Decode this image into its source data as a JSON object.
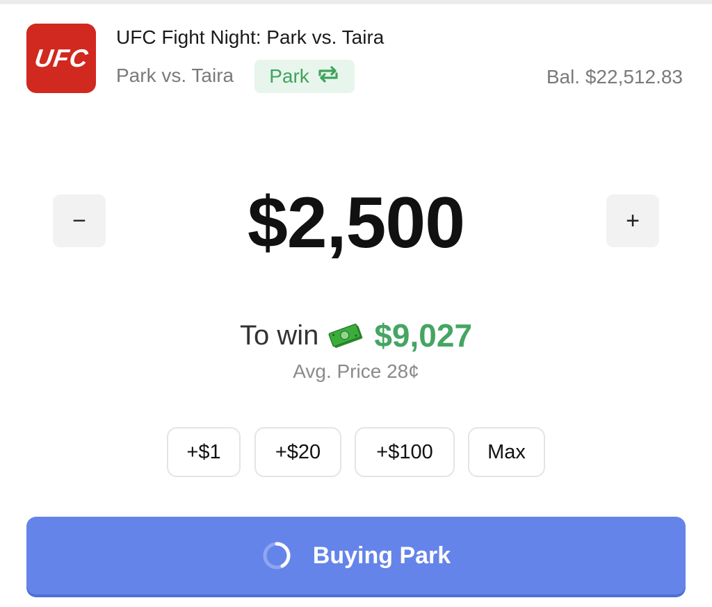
{
  "header": {
    "logo_text": "UFC",
    "event_title": "UFC Fight Night: Park vs. Taira",
    "matchup": "Park vs. Taira",
    "pick_label": "Park",
    "pick_icon": "swap-icon",
    "balance": "Bal. $22,512.83"
  },
  "wager": {
    "decrement_label": "−",
    "increment_label": "+",
    "amount": "$2,500"
  },
  "payout": {
    "to_win_label": "To win",
    "money_icon": "money-icon",
    "to_win_value": "$9,027",
    "avg_price": "Avg. Price 28¢"
  },
  "quick_add": [
    "+$1",
    "+$20",
    "+$100",
    "Max"
  ],
  "buy_button": {
    "label": "Buying Park",
    "spinner_icon": "loading-spinner-icon"
  },
  "colors": {
    "brand_red": "#d1281f",
    "accent_green": "#45a562",
    "button_blue": "#6584ea"
  }
}
